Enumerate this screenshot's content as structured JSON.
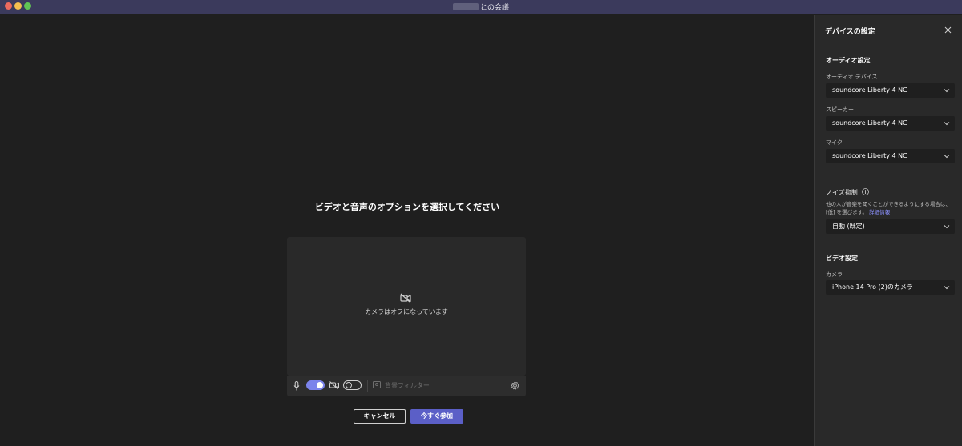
{
  "window": {
    "title": "との会議"
  },
  "stage": {
    "heading": "ビデオと音声のオプションを選択してください",
    "camera_off_label": "カメラはオフになっています",
    "background_filter_label": "背景フィルター",
    "mic_enabled": true,
    "camera_enabled": false,
    "cancel_label": "キャンセル",
    "join_label": "今すぐ参加"
  },
  "panel": {
    "title": "デバイスの設定",
    "audio_section": "オーディオ設定",
    "audio_device_label": "オーディオ デバイス",
    "audio_device_value": "soundcore Liberty 4 NC",
    "speaker_label": "スピーカー",
    "speaker_value": "soundcore Liberty 4 NC",
    "mic_label": "マイク",
    "mic_value": "soundcore Liberty 4 NC",
    "noise_label": "ノイズ抑制",
    "noise_desc": "他の人が音楽を聞くことができるようにする場合は、[低] を選びます。",
    "noise_link": "詳細情報",
    "noise_value": "自動 (既定)",
    "video_section": "ビデオ設定",
    "camera_label": "カメラ",
    "camera_value": "iPhone 14 Pro (2)のカメラ"
  },
  "colors": {
    "accent": "#5b5fc7",
    "toggle_on": "#7b83eb",
    "titlebar": "#3b3a5c"
  }
}
